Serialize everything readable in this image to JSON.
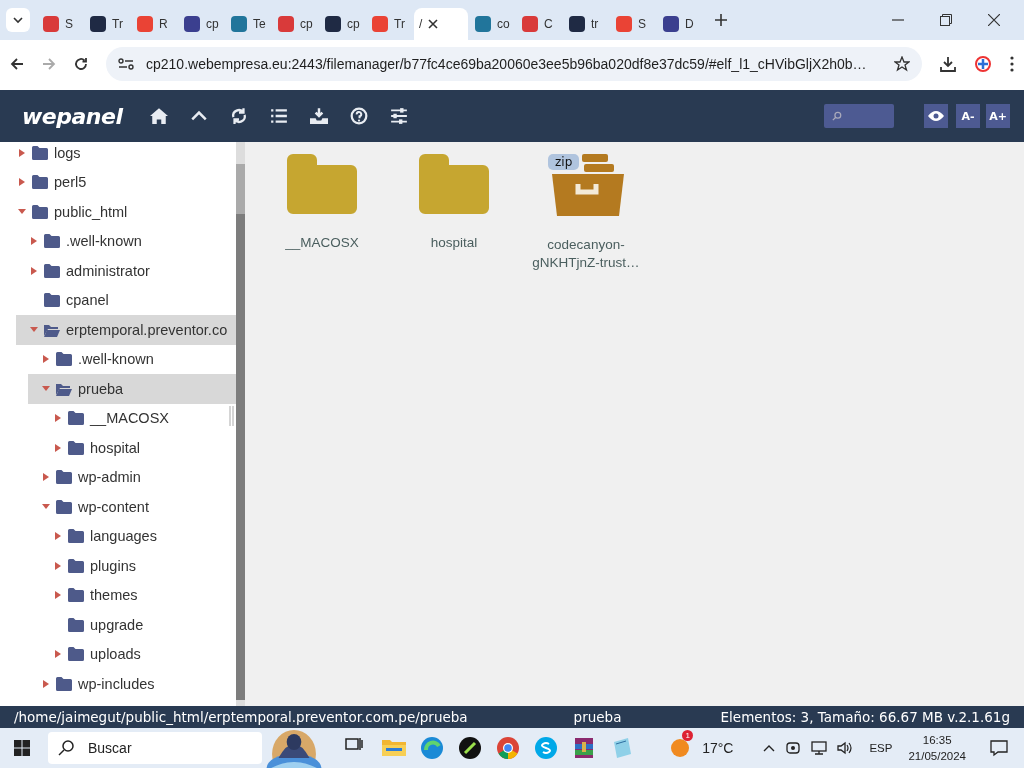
{
  "browser": {
    "tabs": [
      {
        "label": "S",
        "selected": false
      },
      {
        "label": "Tr",
        "selected": false
      },
      {
        "label": "R",
        "selected": false
      },
      {
        "label": "cp",
        "selected": false
      },
      {
        "label": "Te",
        "selected": false
      },
      {
        "label": "cp",
        "selected": false
      },
      {
        "label": "cp",
        "selected": false
      },
      {
        "label": "Tr",
        "selected": false
      },
      {
        "label": "/",
        "selected": true
      },
      {
        "label": "co",
        "selected": false
      },
      {
        "label": "C",
        "selected": false
      },
      {
        "label": "tr",
        "selected": false
      },
      {
        "label": "S",
        "selected": false
      },
      {
        "label": "D",
        "selected": false
      }
    ],
    "url": "cp210.webempresa.eu:2443/filemanager/b77fc4ce69ba20060e3ee5b96ba020df8e37dc59/#elf_l1_cHVibGljX2h0b…"
  },
  "app": {
    "logo": "wepanel",
    "font_buttons": [
      "A-",
      "A+"
    ]
  },
  "tree": [
    {
      "label": "logs",
      "expandable": true,
      "expanded": false,
      "selected": false
    },
    {
      "label": "perl5",
      "expandable": true,
      "expanded": false,
      "selected": false
    },
    {
      "label": "public_html",
      "expandable": true,
      "expanded": true,
      "selected": false,
      "children": [
        {
          "label": ".well-known",
          "expandable": true,
          "expanded": false,
          "selected": false
        },
        {
          "label": "administrator",
          "expandable": true,
          "expanded": false,
          "selected": false
        },
        {
          "label": "cpanel",
          "expandable": false,
          "expanded": false,
          "selected": false
        },
        {
          "label": "erptemporal.preventor.co",
          "expandable": true,
          "expanded": true,
          "selected": true,
          "children": [
            {
              "label": ".well-known",
              "expandable": true,
              "expanded": false,
              "selected": false
            },
            {
              "label": "prueba",
              "expandable": true,
              "expanded": true,
              "selected": true,
              "children": [
                {
                  "label": "__MACOSX",
                  "expandable": true,
                  "expanded": false,
                  "selected": false
                },
                {
                  "label": "hospital",
                  "expandable": true,
                  "expanded": false,
                  "selected": false
                }
              ]
            },
            {
              "label": "wp-admin",
              "expandable": true,
              "expanded": false,
              "selected": false
            },
            {
              "label": "wp-content",
              "expandable": true,
              "expanded": true,
              "selected": false,
              "children": [
                {
                  "label": "languages",
                  "expandable": true,
                  "expanded": false,
                  "selected": false
                },
                {
                  "label": "plugins",
                  "expandable": true,
                  "expanded": false,
                  "selected": false
                },
                {
                  "label": "themes",
                  "expandable": true,
                  "expanded": false,
                  "selected": false
                },
                {
                  "label": "upgrade",
                  "expandable": false,
                  "expanded": false,
                  "selected": false
                },
                {
                  "label": "uploads",
                  "expandable": true,
                  "expanded": false,
                  "selected": false
                }
              ]
            },
            {
              "label": "wp-includes",
              "expandable": true,
              "expanded": false,
              "selected": false
            }
          ]
        }
      ]
    }
  ],
  "files": [
    {
      "kind": "folder",
      "name": "__MACOSX"
    },
    {
      "kind": "folder",
      "name": "hospital"
    },
    {
      "kind": "archive",
      "badge": "zip",
      "name": "codecanyon-gNKHTjnZ-trust…"
    }
  ],
  "status_bar": {
    "path": "/home/jaimegut/public_html/erptemporal.preventor.com.pe/prueba",
    "folder": "prueba",
    "info": "Elementos: 3, Tamaño: 66.67 MB v.2.1.61g"
  },
  "taskbar": {
    "search": "Buscar",
    "weather": "17°C",
    "weather_badge": "1",
    "language": "ESP",
    "time": "16:35",
    "date": "21/05/2024"
  }
}
